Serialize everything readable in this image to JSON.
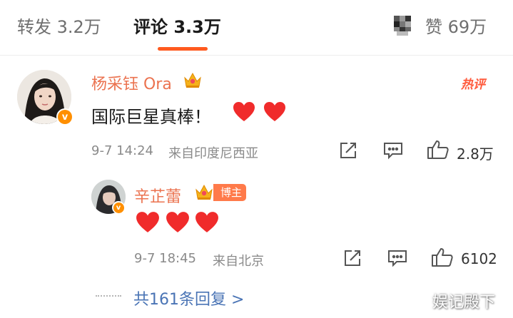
{
  "tabs": {
    "repost": "转发 3.2万",
    "comments": "评论 3.3万",
    "likes": "赞 69万"
  },
  "comment": {
    "username": "杨采钰 Ora",
    "hot_badge": "热评",
    "text": "国际巨星真棒！",
    "timestamp": "9-7 14:24",
    "source": "来自印度尼西亚",
    "like_count": "2.8万"
  },
  "reply": {
    "username": "辛芷蕾",
    "role_badge": "博主",
    "timestamp": "9-7 18:45",
    "source": "来自北京",
    "like_count": "6102",
    "view_replies": "共161条回复 >"
  },
  "watermark": "娱记殿下",
  "colors": {
    "accent": "#ff5a1f",
    "username": "#eb7350",
    "heart": "#f02b2b",
    "link": "#4a74b5",
    "verified": "#ff8f00"
  },
  "icons": [
    "share-icon",
    "comment-icon",
    "like-icon",
    "heart-icon",
    "crown-icon",
    "verified-icon"
  ]
}
